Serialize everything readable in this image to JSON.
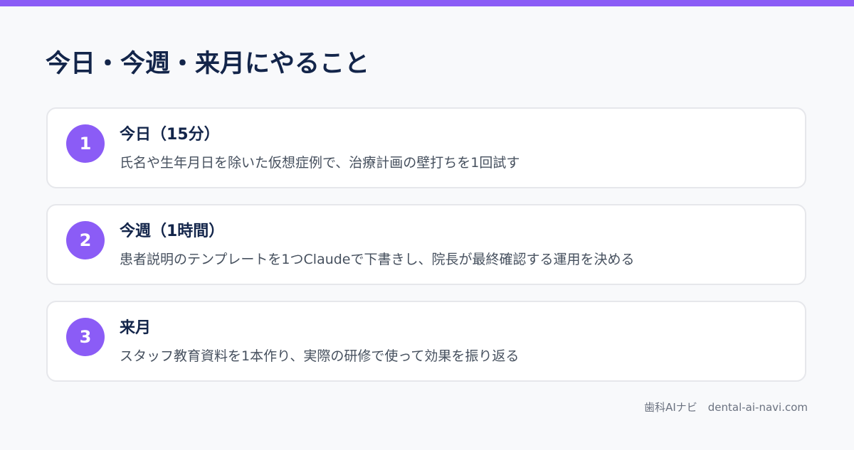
{
  "title": "今日・今週・来月にやること",
  "accent_color": "#8b5cf6",
  "items": [
    {
      "number": "1",
      "title": "今日（15分）",
      "description": "氏名や生年月日を除いた仮想症例で、治療計画の壁打ちを1回試す"
    },
    {
      "number": "2",
      "title": "今週（1時間）",
      "description": "患者説明のテンプレートを1つClaudeで下書きし、院長が最終確認する運用を決める"
    },
    {
      "number": "3",
      "title": "来月",
      "description": "スタッフ教育資料を1本作り、実際の研修で使って効果を振り返る"
    }
  ],
  "footer": {
    "text": "歯科AIナビ　dental-ai-navi.com"
  }
}
